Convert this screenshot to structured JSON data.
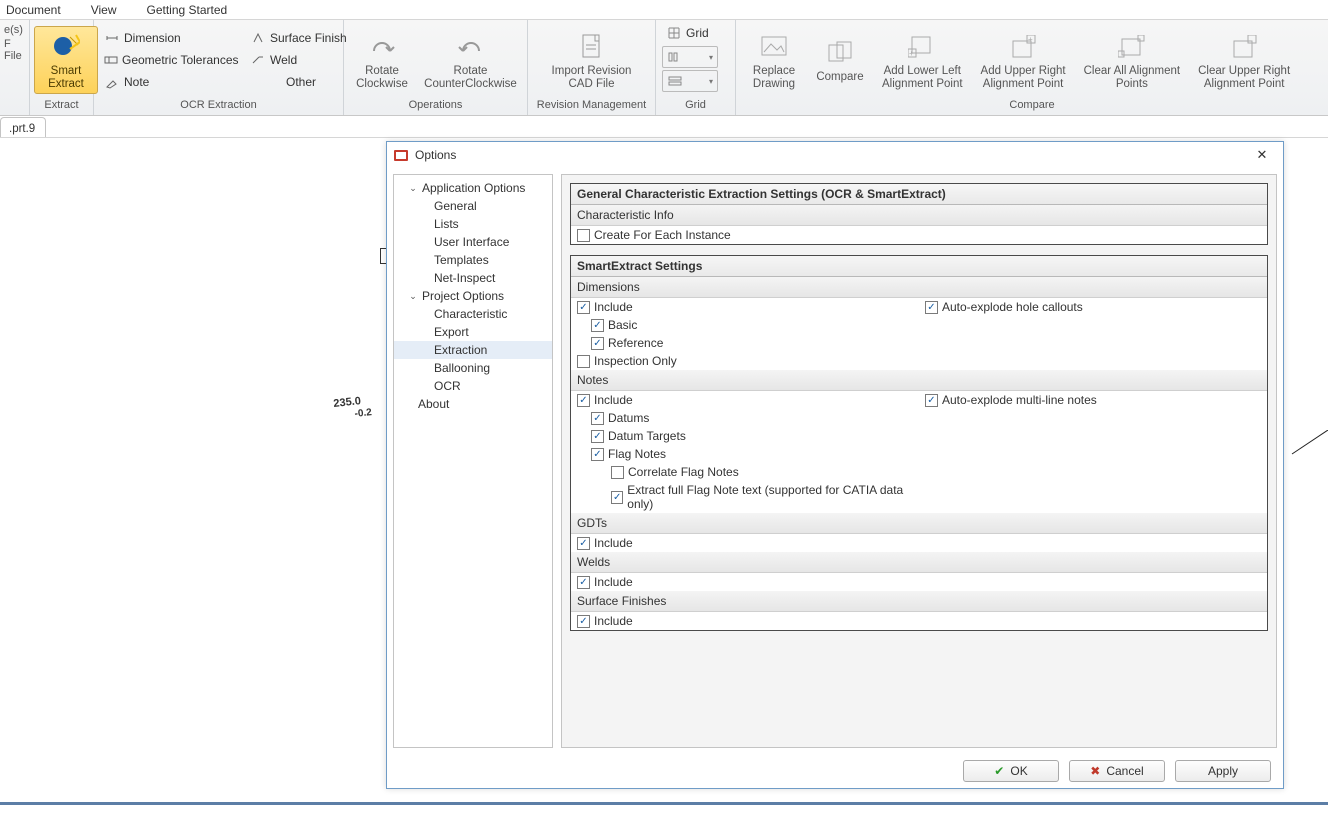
{
  "menubar": [
    "Document",
    "View",
    "Getting Started"
  ],
  "stack_left": {
    "l0": "e(s)",
    "l1": "F File"
  },
  "ribbon": {
    "extract_group": {
      "smart_extract": "Smart\nExtract",
      "label": "Extract"
    },
    "ocr_group": {
      "dimension": "Dimension",
      "surface_finish": "Surface Finish",
      "gdt": "Geometric Tolerances",
      "weld": "Weld",
      "note": "Note",
      "other": "Other",
      "label": "OCR Extraction"
    },
    "operations_group": {
      "rotate_cw": "Rotate\nClockwise",
      "rotate_ccw": "Rotate\nCounterClockwise",
      "label": "Operations"
    },
    "revision_group": {
      "import_rev": "Import Revision\nCAD File",
      "label": "Revision Management"
    },
    "grid_group": {
      "grid": "Grid",
      "label": "Grid"
    },
    "compare_group": {
      "replace": "Replace\nDrawing",
      "compare": "Compare",
      "add_lower_left": "Add Lower Left\nAlignment Point",
      "add_upper_right": "Add Upper Right\nAlignment Point",
      "clear_all": "Clear All Alignment\nPoints",
      "clear_upper_right": "Clear Upper Right\nAlignment Point",
      "label": "Compare"
    }
  },
  "tab": ".prt.9",
  "canvas": {
    "annot1": "235.0",
    "annot2": "-0.2"
  },
  "dialog": {
    "title": "Options",
    "tree": {
      "app_options": "Application Options",
      "general": "General",
      "lists": "Lists",
      "ui": "User Interface",
      "templates": "Templates",
      "net_inspect": "Net-Inspect",
      "proj_options": "Project Options",
      "characteristic": "Characteristic",
      "export": "Export",
      "extraction": "Extraction",
      "ballooning": "Ballooning",
      "ocr": "OCR",
      "about": "About"
    },
    "general_panel_title": "General Characteristic Extraction Settings (OCR & SmartExtract)",
    "char_info_title": "Characteristic Info",
    "create_for_each": "Create For Each Instance",
    "smart_panel_title": "SmartExtract Settings",
    "dimensions": {
      "title": "Dimensions",
      "include": "Include",
      "basic": "Basic",
      "reference": "Reference",
      "inspection_only": "Inspection Only",
      "auto_explode": "Auto-explode hole callouts"
    },
    "notes": {
      "title": "Notes",
      "include": "Include",
      "datums": "Datums",
      "datum_targets": "Datum Targets",
      "flag_notes": "Flag Notes",
      "correlate": "Correlate Flag Notes",
      "extract_full": "Extract full Flag Note text (supported for CATIA data only)",
      "auto_explode": "Auto-explode multi-line notes"
    },
    "gdts": {
      "title": "GDTs",
      "include": "Include"
    },
    "welds": {
      "title": "Welds",
      "include": "Include"
    },
    "surface_finishes": {
      "title": "Surface Finishes",
      "include": "Include"
    },
    "buttons": {
      "ok": "OK",
      "cancel": "Cancel",
      "apply": "Apply"
    }
  }
}
